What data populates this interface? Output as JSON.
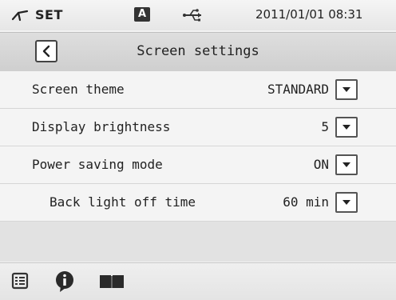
{
  "status": {
    "mode_icon": "welding-torch-icon",
    "mode_label": "SET",
    "a_badge": "A",
    "usb_icon": "usb-icon",
    "datetime": "2011/01/01 08:31"
  },
  "header": {
    "back_icon": "chevron-left-icon",
    "title": "Screen settings"
  },
  "settings": [
    {
      "label": "Screen theme",
      "value": "STANDARD"
    },
    {
      "label": "Display brightness",
      "value": "5"
    },
    {
      "label": "Power saving mode",
      "value": "ON"
    },
    {
      "label": "Back light off time",
      "value": "60 min"
    }
  ],
  "footer": {
    "icons": [
      "list-icon",
      "info-icon",
      "manual-book-icon"
    ]
  },
  "colors": {
    "background": "#f4f4f4",
    "header": "#d6d6d6",
    "text": "#222222"
  }
}
